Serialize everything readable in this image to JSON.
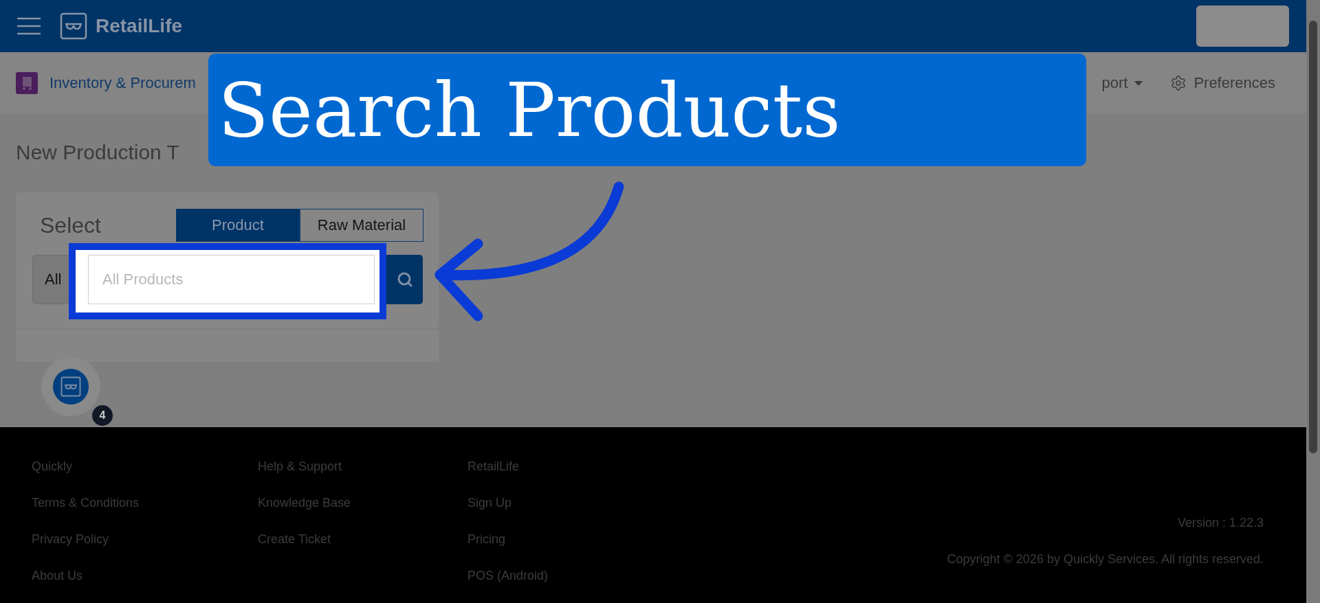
{
  "header": {
    "brand": "RetailLife"
  },
  "nav": {
    "module": "Inventory & Procurem",
    "items": [
      {
        "label": "port",
        "kind": "dropdown"
      },
      {
        "label": "Preferences",
        "kind": "settings"
      }
    ]
  },
  "page": {
    "title": "New Production T"
  },
  "selector": {
    "label": "Select",
    "tabs": [
      {
        "label": "Product",
        "selected": true
      },
      {
        "label": "Raw Material",
        "selected": false
      }
    ],
    "filter": "All",
    "search": {
      "placeholder": "All Products"
    }
  },
  "callout": {
    "text": "Search Products"
  },
  "footer": {
    "columns": [
      [
        "Quickly",
        "Terms & Conditions",
        "Privacy Policy",
        "About Us"
      ],
      [
        "Help & Support",
        "Knowledge Base",
        "Create Ticket"
      ],
      [
        "RetailLife",
        "Sign Up",
        "Pricing",
        "POS (Android)"
      ]
    ],
    "version": "Version : 1.22.3",
    "copyright": "Copyright © 2026 by Quickly Services. All rights reserved."
  },
  "chat": {
    "badge": "4"
  }
}
